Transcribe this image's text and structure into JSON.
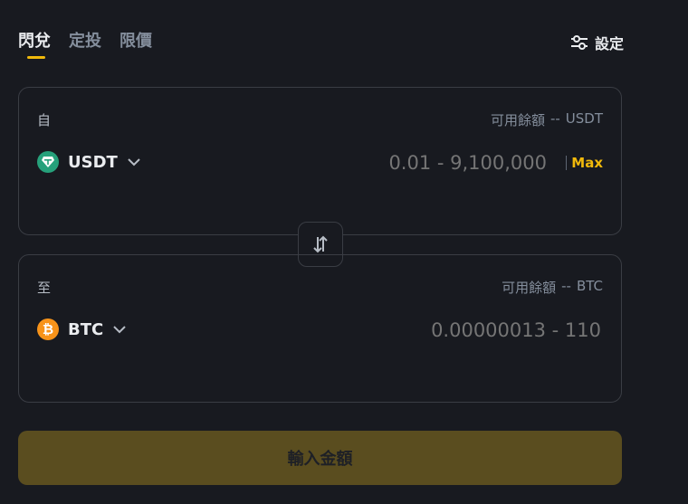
{
  "tabs": [
    {
      "label": "閃兌",
      "active": true
    },
    {
      "label": "定投",
      "active": false
    },
    {
      "label": "限價",
      "active": false
    }
  ],
  "settings": {
    "label": "設定",
    "icon": "sliders-icon"
  },
  "from": {
    "label": "自",
    "available_label": "可用餘額",
    "available_value": "--",
    "available_currency": "USDT",
    "token": "USDT",
    "token_icon": "tether-icon",
    "token_color": "#26a17b",
    "placeholder": "0.01 - 9,100,000",
    "max_label": "Max"
  },
  "swap": {
    "icon": "swap-arrows-icon"
  },
  "to": {
    "label": "至",
    "available_label": "可用餘額",
    "available_value": "--",
    "available_currency": "BTC",
    "token": "BTC",
    "token_icon": "bitcoin-icon",
    "token_color": "#f7931a",
    "placeholder": "0.00000013 - 110"
  },
  "submit": {
    "label": "輸入金額"
  },
  "colors": {
    "accent": "#f0b90b",
    "background": "#181a20",
    "border": "#3a3d44"
  }
}
